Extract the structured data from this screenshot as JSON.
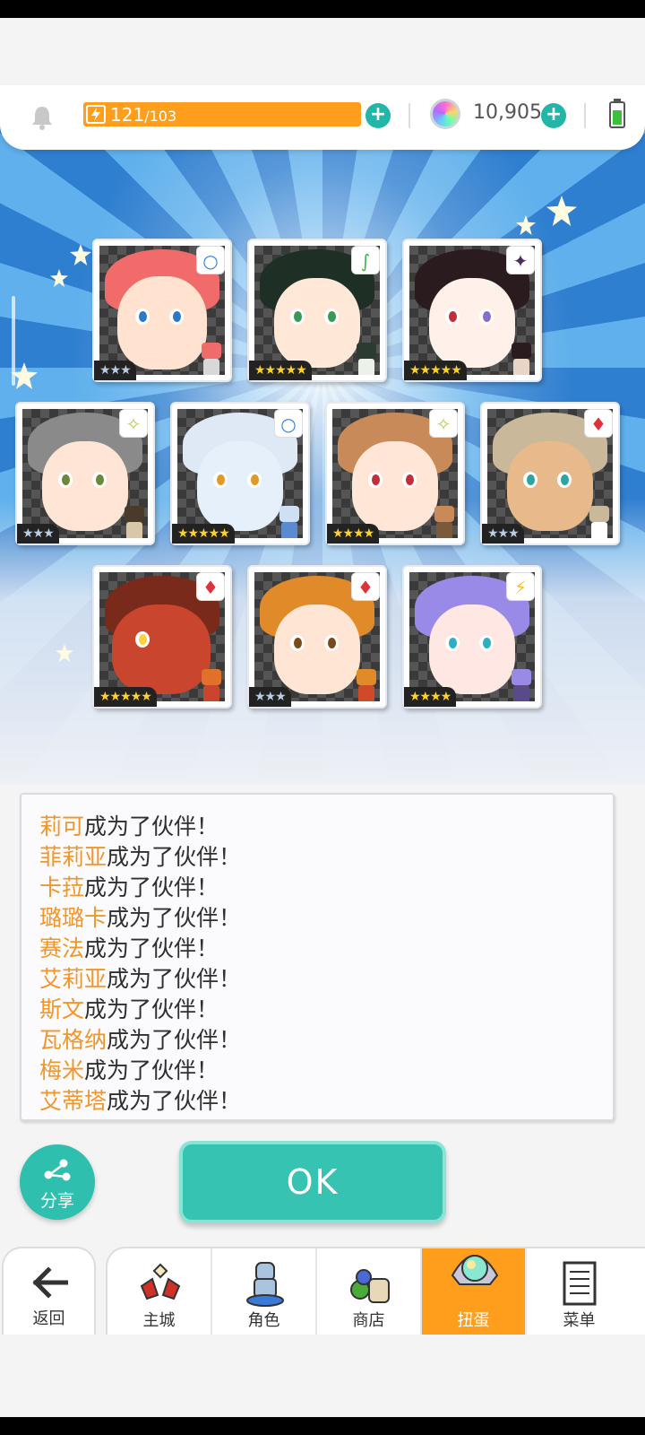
{
  "topbar": {
    "stamina_current": "121",
    "stamina_max": "/103",
    "gem_count": "10,905",
    "colors": {
      "stamina": "#ff9d1c",
      "plus": "#22b6a8"
    }
  },
  "cards": [
    {
      "stars": "★★★",
      "element": "○",
      "tier": "silver"
    },
    {
      "stars": "★★★★★",
      "element": "∫",
      "tier": "gold"
    },
    {
      "stars": "★★★★★",
      "element": "✦",
      "tier": "gold"
    },
    {
      "stars": "★★★",
      "element": "✧",
      "tier": "silver"
    },
    {
      "stars": "★★★★★",
      "element": "○",
      "tier": "gold"
    },
    {
      "stars": "★★★★",
      "element": "✧",
      "tier": "gold"
    },
    {
      "stars": "★★★",
      "element": "♦",
      "tier": "silver"
    },
    {
      "stars": "★★★★★",
      "element": "♦",
      "tier": "gold"
    },
    {
      "stars": "★★★",
      "element": "♦",
      "tier": "silver"
    },
    {
      "stars": "★★★★",
      "element": "⚡",
      "tier": "gold"
    }
  ],
  "messages": {
    "suffix": "成为了伙伴！",
    "names": [
      "莉可",
      "菲莉亚",
      "卡菈",
      "璐璐卡",
      "赛法",
      "艾莉亚",
      "斯文",
      "瓦格纳",
      "梅米",
      "艾蒂塔"
    ]
  },
  "buttons": {
    "share": "分享",
    "ok": "OK"
  },
  "nav": {
    "back": "返回",
    "items": [
      "主城",
      "角色",
      "商店",
      "扭蛋",
      "菜单"
    ],
    "active": "扭蛋"
  }
}
